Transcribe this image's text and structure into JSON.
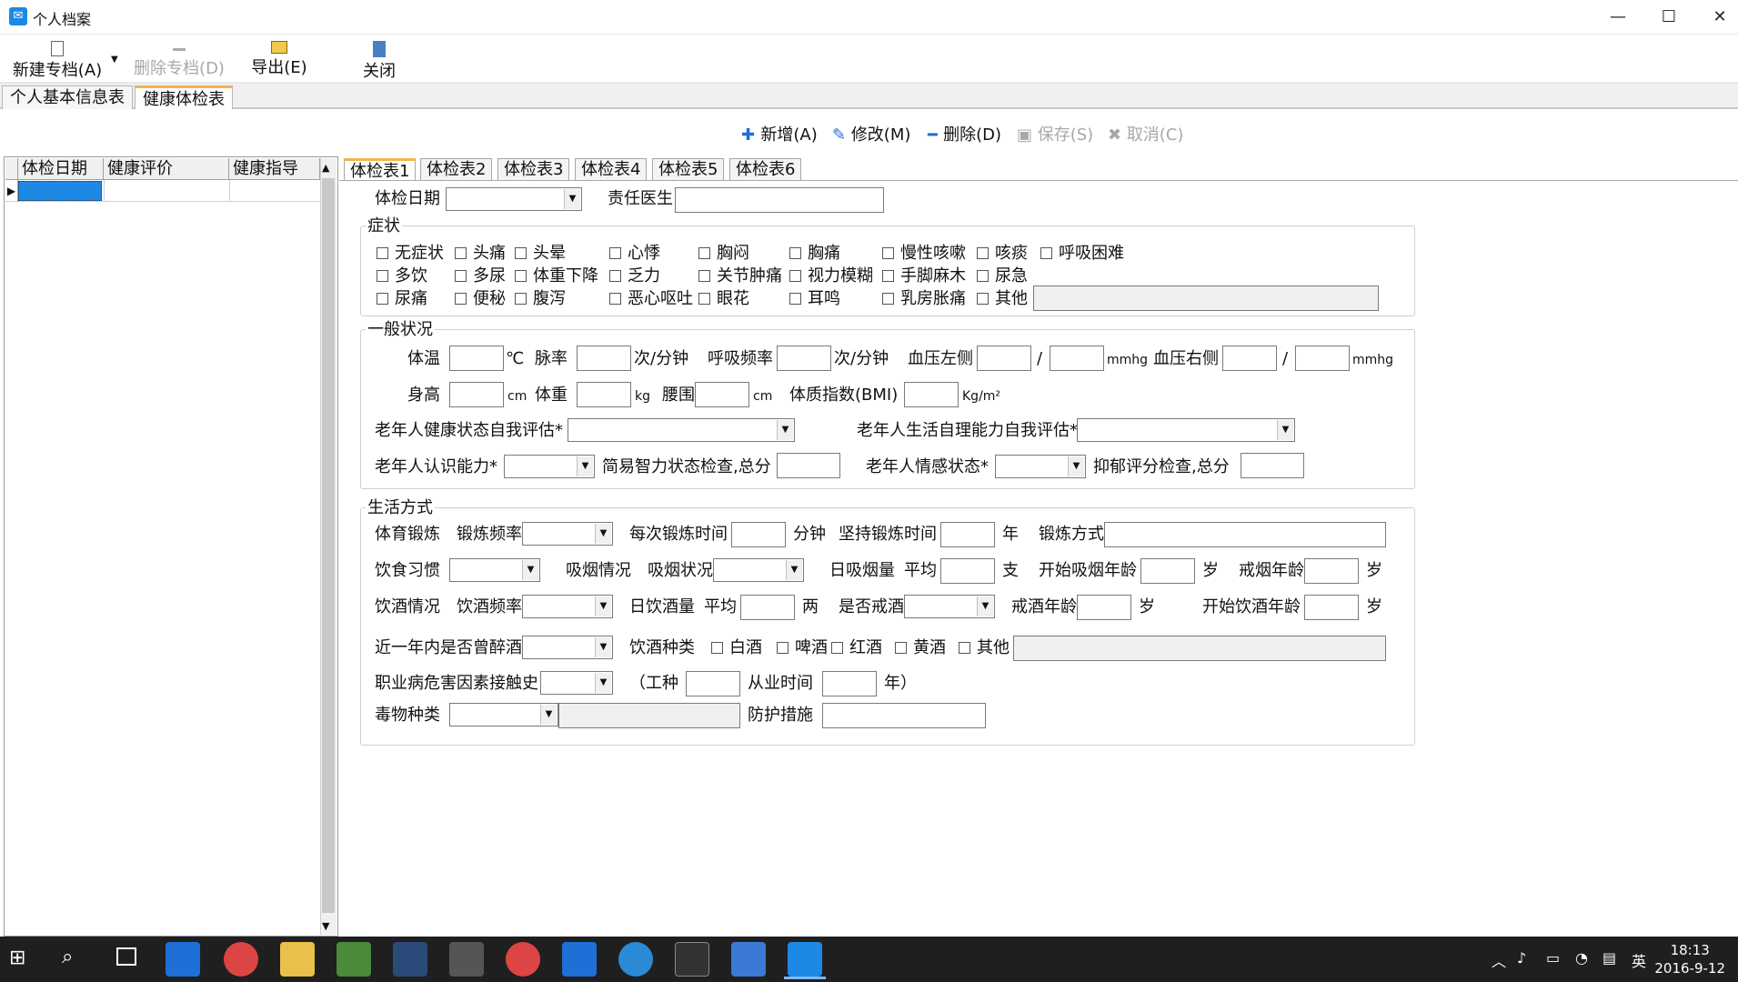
{
  "window": {
    "title": "个人档案",
    "min": "—",
    "max": "☐",
    "close": "✕"
  },
  "toolbar": {
    "new": "新建专档(A)",
    "delete": "删除专档(D)",
    "export": "导出(E)",
    "close": "关闭"
  },
  "main_tabs": [
    "个人基本信息表",
    "健康体检表"
  ],
  "actions": {
    "add": "新增(A)",
    "edit": "修改(M)",
    "delete": "删除(D)",
    "save": "保存(S)",
    "cancel": "取消(C)"
  },
  "grid": {
    "columns": [
      "体检日期",
      "健康评价",
      "健康指导"
    ]
  },
  "exam_tabs": [
    "体检表1",
    "体检表2",
    "体检表3",
    "体检表4",
    "体检表5",
    "体检表6"
  ],
  "form": {
    "exam_date": "体检日期",
    "doctor": "责任医生",
    "symptoms": {
      "title": "症状",
      "items": [
        "无症状",
        "头痛",
        "头晕",
        "心悸",
        "胸闷",
        "胸痛",
        "慢性咳嗽",
        "咳痰",
        "呼吸困难",
        "多饮",
        "多尿",
        "体重下降",
        "乏力",
        "关节肿痛",
        "视力模糊",
        "手脚麻木",
        "尿急",
        "尿痛",
        "便秘",
        "腹泻",
        "恶心呕吐",
        "眼花",
        "耳鸣",
        "乳房胀痛",
        "其他"
      ]
    },
    "general": {
      "title": "一般状况",
      "temp": "体温",
      "temp_unit": "℃",
      "pulse": "脉率",
      "pulse_unit": "次/分钟",
      "resp": "呼吸频率",
      "resp_unit": "次/分钟",
      "bp_left": "血压左侧",
      "bp_right": "血压右侧",
      "slash": "/",
      "mmhg": "mmhg",
      "height": "身高",
      "cm": "cm",
      "weight": "体重",
      "kg": "kg",
      "waist": "腰围",
      "bmi": "体质指数(BMI)",
      "bmi_unit": "Kg/m²",
      "elder_health": "老年人健康状态自我评估*",
      "elder_self": "老年人生活自理能力自我评估*",
      "elder_cog": "老年人认识能力*",
      "mmse": "简易智力状态检查,总分",
      "elder_emotion": "老年人情感状态*",
      "depression": "抑郁评分检查,总分"
    },
    "lifestyle": {
      "title": "生活方式",
      "exercise": "体育锻炼",
      "ex_freq": "锻炼频率",
      "ex_time": "每次锻炼时间",
      "minute": "分钟",
      "ex_years": "坚持锻炼时间",
      "year": "年",
      "ex_method": "锻炼方式",
      "diet": "饮食习惯",
      "smoke": "吸烟情况",
      "smoke_status": "吸烟状况",
      "daily_smoke": "日吸烟量",
      "avg": "平均",
      "zhi": "支",
      "smoke_start": "开始吸烟年龄",
      "sui": "岁",
      "quit_smoke": "戒烟年龄",
      "drink": "饮酒情况",
      "drink_freq": "饮酒频率",
      "daily_drink": "日饮酒量",
      "liang": "两",
      "quit_drink_q": "是否戒酒",
      "quit_drink_age": "戒酒年龄",
      "drink_start": "开始饮酒年龄",
      "drunk": "近一年内是否曾醉酒",
      "liquor_type": "饮酒种类",
      "liquors": [
        "白酒",
        "啤酒",
        "红酒",
        "黄酒",
        "其他"
      ],
      "occupation": "职业病危害因素接触史",
      "job_type": "（工种",
      "work_time": "从业时间",
      "year_close": "年）",
      "poison": "毒物种类",
      "protect": "防护措施"
    }
  },
  "taskbar": {
    "time": "18:13",
    "date": "2016-9-12",
    "ime": "英"
  }
}
